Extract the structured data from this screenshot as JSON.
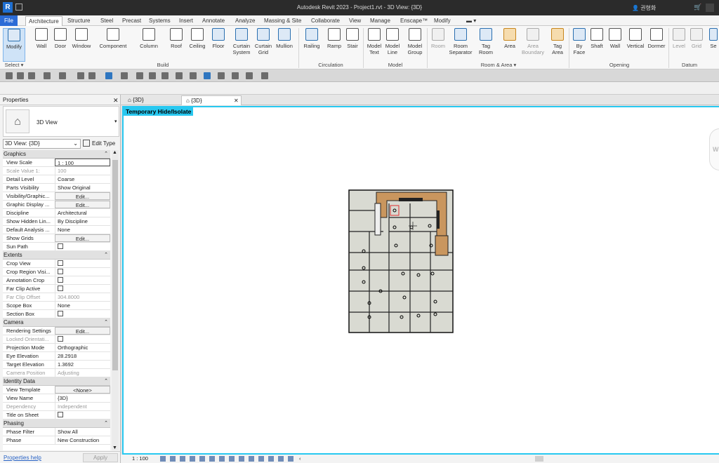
{
  "titlebar": {
    "title": "Autodesk Revit 2023 - Project1.rvt - 3D View: {3D}",
    "user": "👤 권형화",
    "app_letter": "R",
    "cart": "🛒"
  },
  "ribbon_tabs": [
    "File",
    "Architecture",
    "Structure",
    "Steel",
    "Precast",
    "Systems",
    "Insert",
    "Annotate",
    "Analyze",
    "Massing & Site",
    "Collaborate",
    "View",
    "Manage",
    "Enscape™",
    "Modify"
  ],
  "active_tab": "Architecture",
  "ribbon": {
    "buttons": [
      {
        "label": "Modify",
        "sub": ""
      },
      {
        "label": "Wall",
        "sub": ""
      },
      {
        "label": "Door",
        "sub": ""
      },
      {
        "label": "Window",
        "sub": ""
      },
      {
        "label": "Component",
        "sub": ""
      },
      {
        "label": "Column",
        "sub": ""
      },
      {
        "label": "Roof",
        "sub": ""
      },
      {
        "label": "Ceiling",
        "sub": ""
      },
      {
        "label": "Floor",
        "sub": ""
      },
      {
        "label": "Curtain",
        "sub": "System"
      },
      {
        "label": "Curtain",
        "sub": "Grid"
      },
      {
        "label": "Mullion",
        "sub": ""
      },
      {
        "label": "Railing",
        "sub": ""
      },
      {
        "label": "Ramp",
        "sub": ""
      },
      {
        "label": "Stair",
        "sub": ""
      },
      {
        "label": "Model",
        "sub": "Text"
      },
      {
        "label": "Model",
        "sub": "Line"
      },
      {
        "label": "Model",
        "sub": "Group"
      },
      {
        "label": "Room",
        "sub": ""
      },
      {
        "label": "Room",
        "sub": "Separator"
      },
      {
        "label": "Tag",
        "sub": "Room"
      },
      {
        "label": "Area",
        "sub": ""
      },
      {
        "label": "Area",
        "sub": "Boundary"
      },
      {
        "label": "Tag",
        "sub": "Area"
      },
      {
        "label": "By",
        "sub": "Face"
      },
      {
        "label": "Shaft",
        "sub": ""
      },
      {
        "label": "Wall",
        "sub": ""
      },
      {
        "label": "Vertical",
        "sub": ""
      },
      {
        "label": "Dormer",
        "sub": ""
      },
      {
        "label": "Level",
        "sub": ""
      },
      {
        "label": "Grid",
        "sub": ""
      },
      {
        "label": "Se",
        "sub": ""
      }
    ],
    "panels": [
      "Select ▾",
      "Build",
      "Circulation",
      "Model",
      "Room & Area ▾",
      "Opening",
      "Datum"
    ]
  },
  "properties": {
    "title": "Properties",
    "type_name": "3D View",
    "view_selector": "3D View: {3D}",
    "edit_type": "Edit Type",
    "groups": [
      {
        "name": "Graphics",
        "rows": [
          {
            "k": "View Scale",
            "v": "1 : 100"
          },
          {
            "k": "Scale Value    1:",
            "v": "100"
          },
          {
            "k": "Detail Level",
            "v": "Coarse"
          },
          {
            "k": "Parts Visibility",
            "v": "Show Original"
          },
          {
            "k": "Visibility/Graphic...",
            "v": "Edit..."
          },
          {
            "k": "Graphic Display ...",
            "v": "Edit..."
          },
          {
            "k": "Discipline",
            "v": "Architectural"
          },
          {
            "k": "Show Hidden Lin...",
            "v": "By Discipline"
          },
          {
            "k": "Default Analysis ...",
            "v": "None"
          },
          {
            "k": "Show Grids",
            "v": "Edit..."
          },
          {
            "k": "Sun Path",
            "v": ""
          }
        ]
      },
      {
        "name": "Extents",
        "rows": [
          {
            "k": "Crop View",
            "v": ""
          },
          {
            "k": "Crop Region Visi...",
            "v": ""
          },
          {
            "k": "Annotation Crop",
            "v": ""
          },
          {
            "k": "Far Clip Active",
            "v": ""
          },
          {
            "k": "Far Clip Offset",
            "v": "304.8000"
          },
          {
            "k": "Scope Box",
            "v": "None"
          },
          {
            "k": "Section Box",
            "v": ""
          }
        ]
      },
      {
        "name": "Camera",
        "rows": [
          {
            "k": "Rendering Settings",
            "v": "Edit..."
          },
          {
            "k": "Locked Orientati...",
            "v": ""
          },
          {
            "k": "Projection Mode",
            "v": "Orthographic"
          },
          {
            "k": "Eye Elevation",
            "v": "28.2918"
          },
          {
            "k": "Target Elevation",
            "v": "1.3692"
          },
          {
            "k": "Camera Position",
            "v": "Adjusting"
          }
        ]
      },
      {
        "name": "Identity Data",
        "rows": [
          {
            "k": "View Template",
            "v": "<None>"
          },
          {
            "k": "View Name",
            "v": "{3D}"
          },
          {
            "k": "Dependency",
            "v": "Independent"
          },
          {
            "k": "Title on Sheet",
            "v": ""
          }
        ]
      },
      {
        "name": "Phasing",
        "rows": [
          {
            "k": "Phase Filter",
            "v": "Show All"
          },
          {
            "k": "Phase",
            "v": "New Construction"
          }
        ]
      }
    ],
    "help_link": "Properties help",
    "apply_label": "Apply"
  },
  "view_tabs": [
    {
      "label": "{3D}"
    },
    {
      "label": "{3D}"
    }
  ],
  "canvas": {
    "banner": "Temporary Hide/Isolate",
    "viewcube_text": "W"
  },
  "status": {
    "scale": "1 : 100"
  }
}
